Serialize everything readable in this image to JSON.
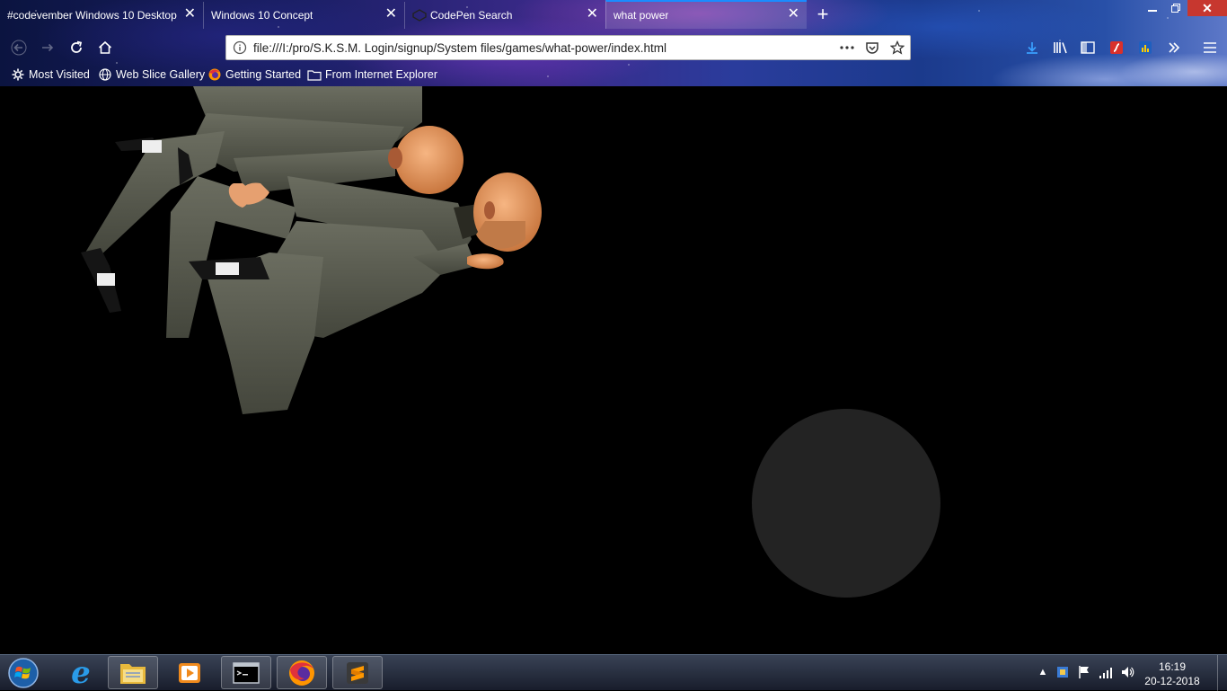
{
  "browser": {
    "tabs": [
      {
        "title": "#codevember Windows 10 Desktop",
        "active": false
      },
      {
        "title": "Windows 10 Concept",
        "active": false
      },
      {
        "title": "CodePen Search",
        "active": false
      },
      {
        "title": "what power",
        "active": true
      }
    ],
    "new_tab_icon": "plus-icon",
    "url": "file:///I:/pro/S.K.S.M. Login/signup/System files/games/what-power/index.html",
    "bookmarks": [
      {
        "label": "Most Visited",
        "icon": "gear-icon"
      },
      {
        "label": "Web Slice Gallery",
        "icon": "globe-icon"
      },
      {
        "label": "Getting Started",
        "icon": "firefox-icon"
      },
      {
        "label": "From Internet Explorer",
        "icon": "folder-icon"
      }
    ]
  },
  "page": {
    "joystick_color": "#232323"
  },
  "taskbar": {
    "apps": [
      "internet-explorer",
      "file-explorer",
      "media-player",
      "command-prompt",
      "firefox",
      "sublime-text"
    ],
    "clock": {
      "time": "16:19",
      "date": "20-12-2018"
    }
  }
}
